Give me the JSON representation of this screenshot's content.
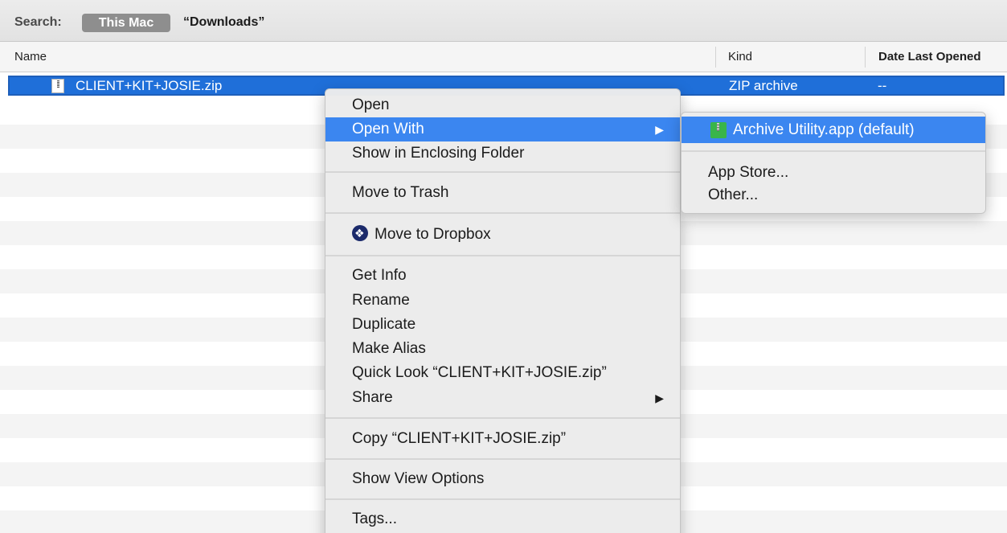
{
  "search": {
    "label": "Search:",
    "scope": "This Mac",
    "location": "“Downloads”"
  },
  "columns": {
    "name": "Name",
    "kind": "Kind",
    "date": "Date Last Opened"
  },
  "files": [
    {
      "name": "CLIENT+KIT+JOSIE.zip",
      "kind": "ZIP archive",
      "date": "--",
      "icon": "zip-file-icon"
    }
  ],
  "context_menu": {
    "items": [
      {
        "label": "Open"
      },
      {
        "label": "Open With",
        "submenu": true
      },
      {
        "label": "Show in Enclosing Folder"
      },
      {
        "label": "Move to Trash"
      },
      {
        "label": "Move to Dropbox",
        "icon": "dropbox-icon"
      },
      {
        "label": "Get Info"
      },
      {
        "label": "Rename"
      },
      {
        "label": "Duplicate"
      },
      {
        "label": "Make Alias"
      },
      {
        "label": "Quick Look “CLIENT+KIT+JOSIE.zip”"
      },
      {
        "label": "Share",
        "submenu": true
      },
      {
        "label": "Copy “CLIENT+KIT+JOSIE.zip”"
      },
      {
        "label": "Show View Options"
      },
      {
        "label": "Tags..."
      }
    ],
    "highlighted": "Open With"
  },
  "open_with_submenu": {
    "items": [
      {
        "label": "Archive Utility.app (default)",
        "icon": "archive-utility-icon"
      },
      {
        "label": "App Store..."
      },
      {
        "label": "Other..."
      }
    ]
  },
  "colors": {
    "selection": "#1f6fd9",
    "menu_highlight": "#3b86f0",
    "menu_background": "#ececec"
  }
}
